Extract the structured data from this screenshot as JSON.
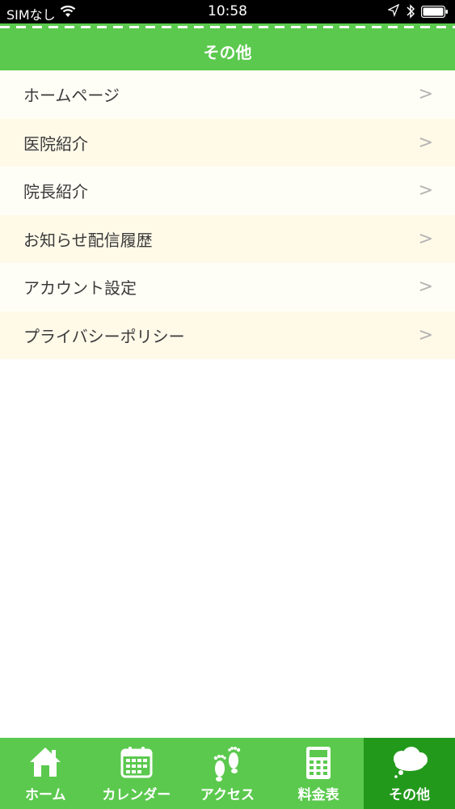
{
  "status_bar": {
    "carrier": "SIMなし",
    "time": "10:58"
  },
  "header": {
    "title": "その他"
  },
  "menu": {
    "chevron": ">",
    "items": [
      {
        "label": "ホームページ"
      },
      {
        "label": "医院紹介"
      },
      {
        "label": "院長紹介"
      },
      {
        "label": "お知らせ配信履歴"
      },
      {
        "label": "アカウント設定"
      },
      {
        "label": "プライバシーポリシー"
      }
    ]
  },
  "tab_bar": {
    "active_tab": "その他",
    "tabs": [
      {
        "label": "ホーム",
        "icon": "home-icon"
      },
      {
        "label": "カレンダー",
        "icon": "calendar-icon"
      },
      {
        "label": "アクセス",
        "icon": "footprints-icon"
      },
      {
        "label": "料金表",
        "icon": "calculator-icon"
      },
      {
        "label": "その他",
        "icon": "speech-bubble-icon"
      }
    ]
  },
  "colors": {
    "accent": "#5bc94e",
    "active_tab": "#23991c",
    "row_light": "#fffef6",
    "row_tint": "#fff9e8",
    "chevron": "#b3b3b3"
  }
}
